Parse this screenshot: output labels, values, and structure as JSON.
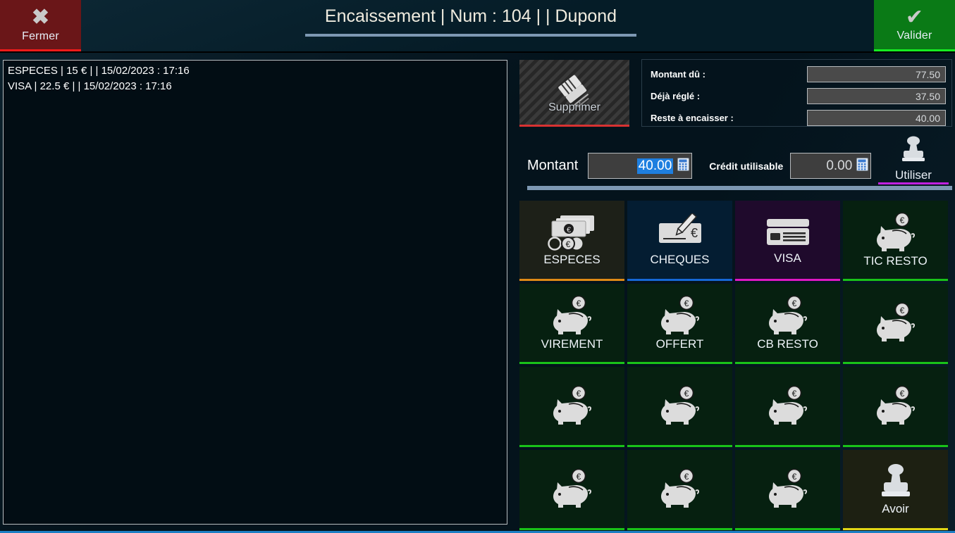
{
  "header": {
    "close_label": "Fermer",
    "close_icon": "x-icon",
    "title": "Encaissement | Num : 104 |  | Dupond",
    "validate_label": "Valider",
    "validate_icon": "check-icon"
  },
  "payments_list": [
    {
      "text": "ESPECES | 15 € |    | 15/02/2023 : 17:16"
    },
    {
      "text": "VISA | 22.5 € |    | 15/02/2023 : 17:16"
    }
  ],
  "delete_button": {
    "label": "Supprimer",
    "icon": "eraser-icon"
  },
  "totals": [
    {
      "label": "Montant dû :",
      "value": "77.50"
    },
    {
      "label": "Déjà réglé :",
      "value": "37.50"
    },
    {
      "label": "Reste à encaisser :",
      "value": "40.00"
    }
  ],
  "amount_row": {
    "montant_label": "Montant",
    "montant_value": "40.00",
    "montant_icon": "calculator-icon",
    "credit_label": "Crédit utilisable",
    "credit_value": "0.00",
    "credit_icon": "calculator-icon",
    "use_label": "Utiliser",
    "use_icon": "stamp-icon"
  },
  "tiles": [
    {
      "label": "ESPECES",
      "icon": "banknotes-coins-icon",
      "style": "t-especes"
    },
    {
      "label": "CHEQUES",
      "icon": "cheque-pen-icon",
      "style": "t-cheques"
    },
    {
      "label": "VISA",
      "icon": "credit-card-icon",
      "style": "t-visa"
    },
    {
      "label": "TIC RESTO",
      "icon": "piggy-bank-icon",
      "style": ""
    },
    {
      "label": "VIREMENT",
      "icon": "piggy-bank-icon",
      "style": ""
    },
    {
      "label": "OFFERT",
      "icon": "piggy-bank-icon",
      "style": ""
    },
    {
      "label": "CB RESTO",
      "icon": "piggy-bank-icon",
      "style": ""
    },
    {
      "label": "",
      "icon": "piggy-bank-icon",
      "style": ""
    },
    {
      "label": "",
      "icon": "piggy-bank-icon",
      "style": ""
    },
    {
      "label": "",
      "icon": "piggy-bank-icon",
      "style": ""
    },
    {
      "label": "",
      "icon": "piggy-bank-icon",
      "style": ""
    },
    {
      "label": "",
      "icon": "piggy-bank-icon",
      "style": ""
    },
    {
      "label": "",
      "icon": "piggy-bank-icon",
      "style": ""
    },
    {
      "label": "",
      "icon": "piggy-bank-icon",
      "style": ""
    },
    {
      "label": "",
      "icon": "piggy-bank-icon",
      "style": ""
    },
    {
      "label": "Avoir",
      "icon": "stamp-icon",
      "style": "t-avoir"
    }
  ],
  "colors": {
    "close_accent": "#f21b1b",
    "validate_accent": "#16ec22",
    "delete_accent": "#d93232",
    "use_accent": "#c020e0",
    "tile_default_accent": "#19c219",
    "especes_accent": "#e08a16",
    "cheques_accent": "#1668d6",
    "visa_accent": "#e018c4",
    "avoir_accent": "#e0d616",
    "selection_blue": "#1e7fe0",
    "bottom_border": "#1d7fc4"
  }
}
